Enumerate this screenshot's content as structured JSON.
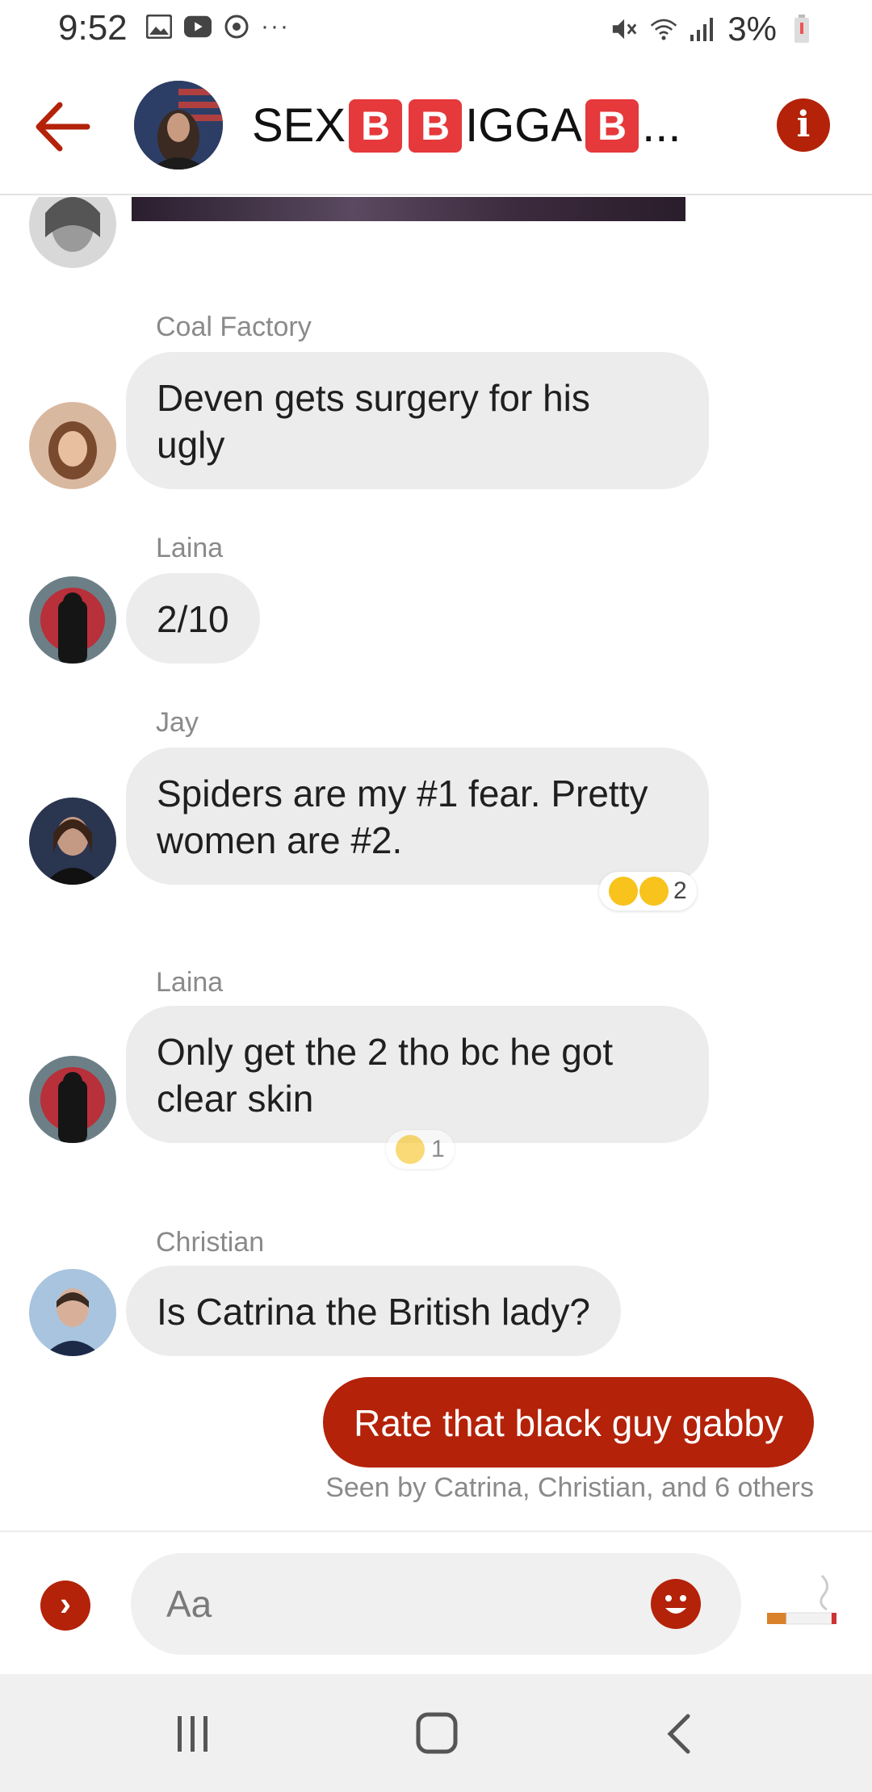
{
  "status_bar": {
    "time": "9:52",
    "battery": "3%",
    "icons": [
      "gallery-icon",
      "youtube-icon",
      "sync-icon",
      "more-icon",
      "mute-icon",
      "wifi-icon",
      "signal-icon",
      "battery-icon"
    ]
  },
  "header": {
    "title_parts": [
      "SEX",
      "B",
      "B",
      "IGGA",
      "B",
      "..."
    ],
    "back_icon": "arrow-left-icon",
    "info_icon": "info-icon",
    "accent": "#b32209"
  },
  "messages": [
    {
      "sender": "Coal Factory",
      "text_line1": "Deven gets surgery for his",
      "text_line2": "ugly"
    },
    {
      "sender": "Laina",
      "text": "2/10"
    },
    {
      "sender": "Jay",
      "text_line1": "Spiders are my #1 fear. Pretty",
      "text_line2": "women are #2.",
      "reaction_count": "2"
    },
    {
      "sender": "Laina",
      "text_line1": "Only get the 2 tho bc he got",
      "text_line2": "clear skin",
      "reaction_count": "1"
    },
    {
      "sender": "Christian",
      "text": "Is Catrina the British lady?"
    },
    {
      "outgoing": true,
      "text": "Rate that black guy gabby"
    }
  ],
  "seen_text": "Seen by Catrina, Christian, and 6 others",
  "composer": {
    "placeholder": "Aa"
  }
}
